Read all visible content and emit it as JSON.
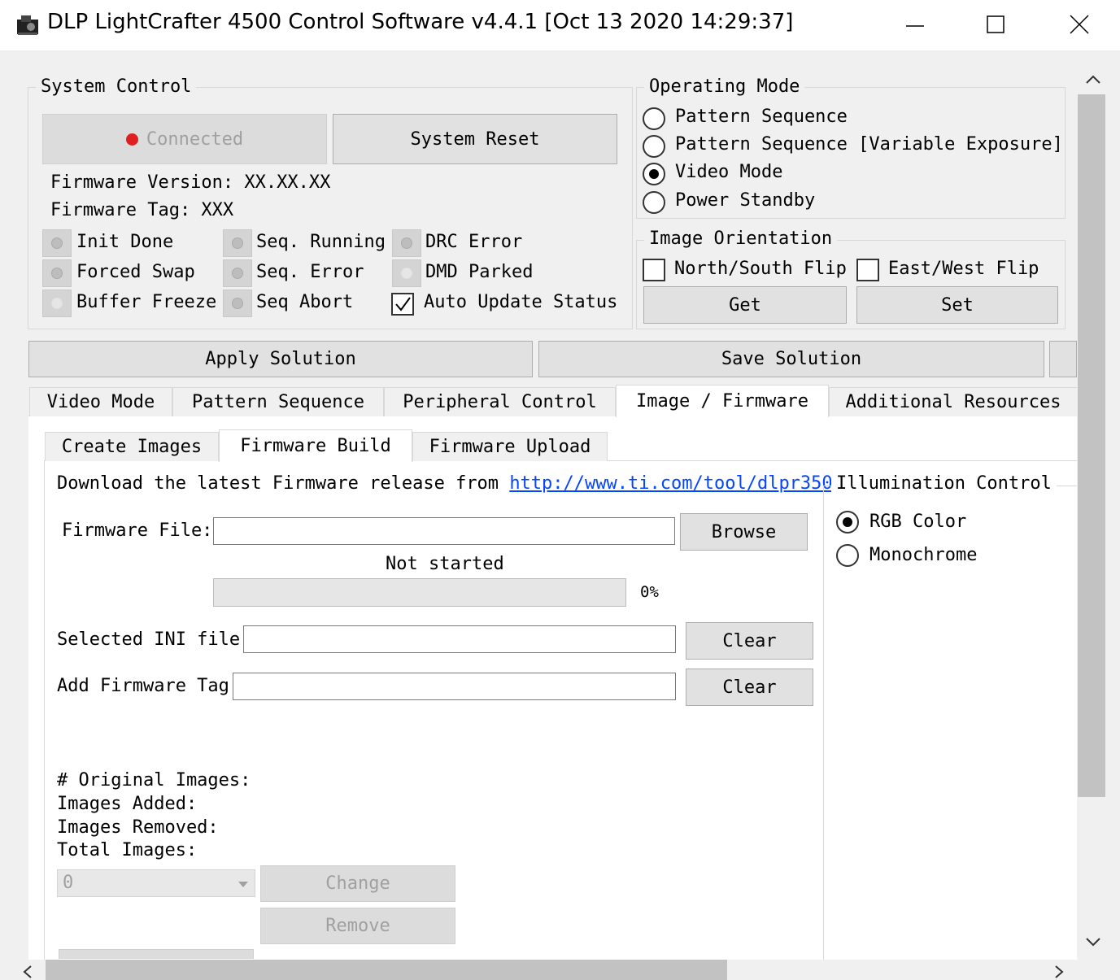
{
  "window": {
    "title": "DLP LightCrafter 4500 Control Software v4.4.1 [Oct 13 2020 14:29:37]"
  },
  "system_control": {
    "title": "System Control",
    "connected_label": "Connected",
    "reset_label": "System Reset",
    "firmware_version": "Firmware Version: XX.XX.XX",
    "firmware_tag": "Firmware Tag:  XXX",
    "status": [
      {
        "label": "Init Done"
      },
      {
        "label": "Seq. Running"
      },
      {
        "label": "DRC Error"
      },
      {
        "label": "Forced Swap"
      },
      {
        "label": "Seq. Error"
      },
      {
        "label": "DMD Parked"
      },
      {
        "label": "Buffer Freeze"
      },
      {
        "label": "Seq Abort"
      }
    ],
    "auto_update_label": "Auto Update Status"
  },
  "operating_mode": {
    "title": "Operating Mode",
    "options": [
      "Pattern Sequence",
      "Pattern Sequence [Variable Exposure]",
      "Video Mode",
      "Power Standby"
    ],
    "selected": "Video Mode"
  },
  "image_orientation": {
    "title": "Image Orientation",
    "ns_flip": "North/South Flip",
    "ew_flip": "East/West Flip",
    "get_label": "Get",
    "set_label": "Set"
  },
  "solution": {
    "apply_label": "Apply Solution",
    "save_label": "Save Solution"
  },
  "main_tabs": [
    "Video Mode",
    "Pattern Sequence",
    "Peripheral Control",
    "Image / Firmware",
    "Additional Resources"
  ],
  "sub_tabs": [
    "Create Images",
    "Firmware Build",
    "Firmware Upload"
  ],
  "firmware_build": {
    "download_text": "Download the latest Firmware release from",
    "download_link": "http://www.ti.com/tool/dlpr350",
    "file_label": "Firmware File:",
    "browse_label": "Browse",
    "progress_status": "Not started",
    "progress_percent": "0%",
    "progress_value": 0,
    "ini_label": "Selected INI file",
    "tag_label": "Add Firmware Tag",
    "clear_label": "Clear",
    "original_images": "# Original Images:",
    "images_added": "Images Added:",
    "images_removed": "Images Removed:",
    "total_images": "Total Images:",
    "combo_value": "0",
    "change_label": "Change",
    "remove_label": "Remove"
  },
  "illumination": {
    "title": "Illumination Control",
    "options": [
      "RGB Color",
      "Monochrome"
    ],
    "selected": "RGB Color"
  },
  "colors": {
    "connected_led": "#e02020",
    "link": "#0645ff"
  }
}
